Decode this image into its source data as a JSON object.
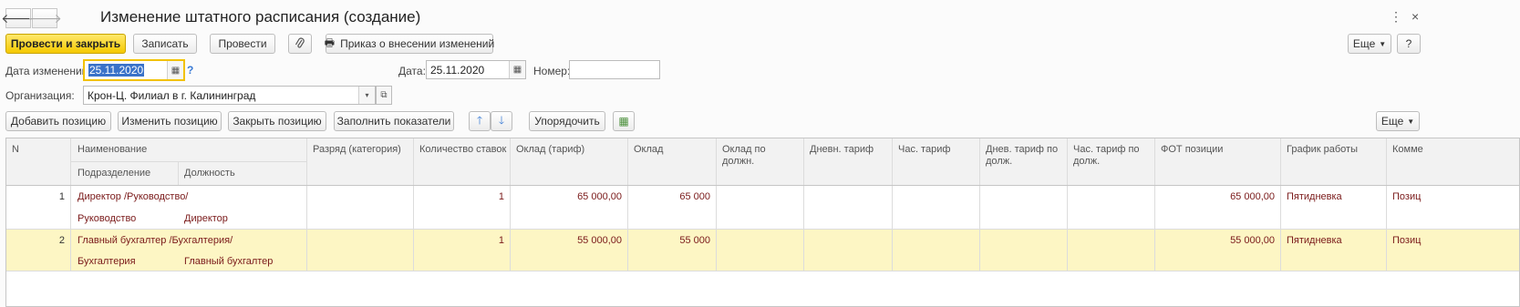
{
  "window": {
    "title": "Изменение штатного расписания (создание)"
  },
  "toolbar": {
    "post_close": "Провести и закрыть",
    "save": "Записать",
    "post": "Провести",
    "order": "Приказ о внесении изменений",
    "more": "Еще",
    "help": "?"
  },
  "header": {
    "change_date_label": "Дата изменений:",
    "change_date_value": "25.11.2020",
    "date_label": "Дата:",
    "date_value": "25.11.2020",
    "number_label": "Номер:",
    "number_value": "",
    "org_label": "Организация:",
    "org_value": "Крон-Ц. Филиал в г. Калининград"
  },
  "table_toolbar": {
    "add": "Добавить позицию",
    "edit": "Изменить позицию",
    "close": "Закрыть позицию",
    "fill": "Заполнить показатели",
    "sort": "Упорядочить",
    "more": "Еще"
  },
  "table": {
    "columns": {
      "n": "N",
      "name": "Наименование",
      "dept": "Подразделение",
      "position": "Должность",
      "grade": "Разряд (категория)",
      "rates": "Количество ставок",
      "salary_tariff": "Оклад (тариф)",
      "salary": "Оклад",
      "salary_by_pos": "Оклад по должн.",
      "day_tariff": "Дневн. тариф",
      "hour_tariff": "Час. тариф",
      "day_tariff_pos": "Днев. тариф по долж.",
      "hour_tariff_pos": "Час. тариф по долж.",
      "payroll": "ФОТ позиции",
      "schedule": "График работы",
      "comment": "Комме"
    },
    "rows": [
      {
        "n": "1",
        "name": "Директор /Руководство/",
        "dept": "Руководство",
        "position": "Директор",
        "rates": "1",
        "salary_tariff": "65 000,00",
        "salary": "65 000",
        "payroll": "65 000,00",
        "schedule": "Пятидневка",
        "comment": "Позиц"
      },
      {
        "n": "2",
        "name": "Главный бухгалтер /Бухгалтерия/",
        "dept": "Бухгалтерия",
        "position": "Главный бухгалтер",
        "rates": "1",
        "salary_tariff": "55 000,00",
        "salary": "55 000",
        "payroll": "55 000,00",
        "schedule": "Пятидневка",
        "comment": "Позиц"
      }
    ]
  }
}
